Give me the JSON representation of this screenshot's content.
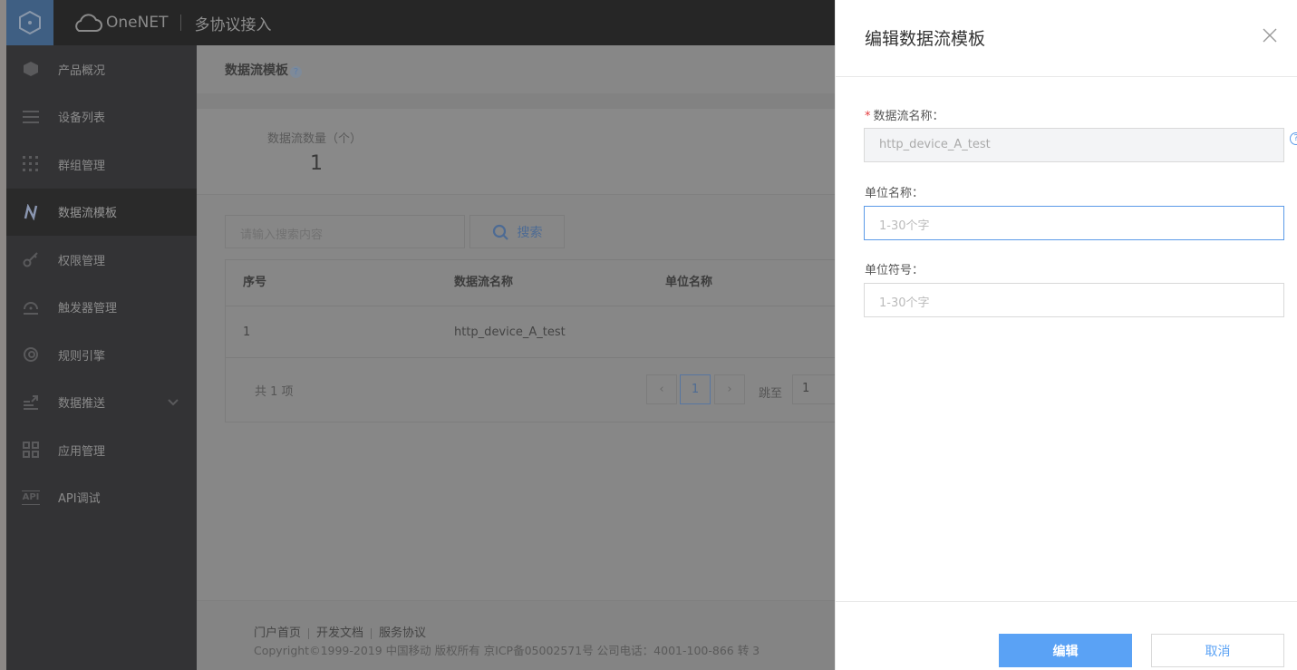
{
  "header": {
    "brand": "OneNET",
    "product": "多协议接入"
  },
  "sidebar": {
    "items": [
      {
        "label": "产品概况",
        "icon": "cube-icon"
      },
      {
        "label": "设备列表",
        "icon": "list-icon"
      },
      {
        "label": "群组管理",
        "icon": "grid-dots-icon"
      },
      {
        "label": "数据流模板",
        "icon": "datastream-icon",
        "active": true
      },
      {
        "label": "权限管理",
        "icon": "key-icon"
      },
      {
        "label": "触发器管理",
        "icon": "trigger-icon"
      },
      {
        "label": "规则引擎",
        "icon": "rule-engine-icon"
      },
      {
        "label": "数据推送",
        "icon": "push-icon",
        "expandable": true
      },
      {
        "label": "应用管理",
        "icon": "apps-icon"
      },
      {
        "label": "API调试",
        "icon": "api-icon"
      }
    ]
  },
  "main": {
    "title": "数据流模板",
    "help": "?",
    "stat": {
      "label": "数据流数量（个）",
      "value": "1"
    },
    "search": {
      "placeholder": "请输入搜索内容",
      "button": "搜索"
    },
    "table": {
      "columns": [
        "序号",
        "数据流名称",
        "单位名称"
      ],
      "rows": [
        [
          "1",
          "http_device_A_test",
          ""
        ]
      ]
    },
    "pagination": {
      "total": "共 1 项",
      "current": "1",
      "prev": "‹",
      "next": "›",
      "jump_label": "跳至",
      "jump_value": "1"
    },
    "footer": {
      "links": [
        "门户首页",
        "开发文档",
        "服务协议"
      ],
      "copyright": "Copyright©1999-2019 中国移动 版权所有 京ICP备05002571号 公司电话：4001-100-866 转 3"
    }
  },
  "drawer": {
    "title": "编辑数据流模板",
    "close": "×",
    "fields": [
      {
        "label": "数据流名称：",
        "required": "*",
        "value": "http_device_A_test",
        "help": "?"
      },
      {
        "label": "单位名称：",
        "placeholder": "1-30个字"
      },
      {
        "label": "单位符号：",
        "placeholder": "1-30个字"
      }
    ],
    "ok": "编辑",
    "cancel": "取消"
  },
  "colors": {
    "accent": "#5aa2f5",
    "logo_bg": "#3f5f83",
    "topbar": "#262626",
    "sidebar": "#333335"
  }
}
